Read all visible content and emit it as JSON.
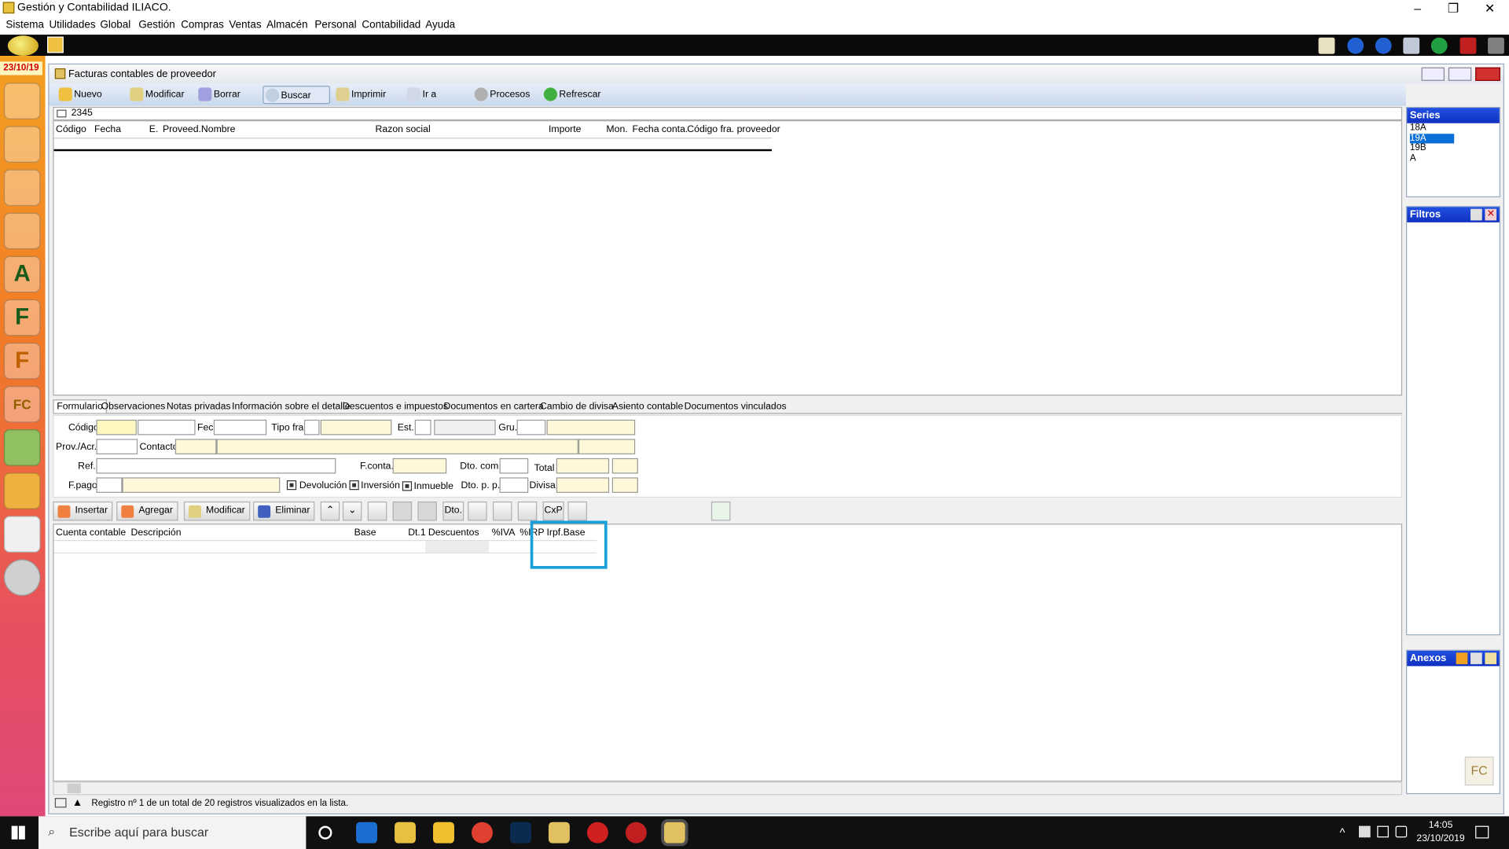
{
  "window": {
    "title": "Gestión y Contabilidad ILIACO.",
    "minimize": "–",
    "restore": "❐",
    "close": "✕"
  },
  "menu": [
    "Sistema",
    "Utilidades",
    "Global",
    "Gestión",
    "Compras",
    "Ventas",
    "Almacén",
    "Personal",
    "Contabilidad",
    "Ayuda"
  ],
  "rail": {
    "date": "23/10/19",
    "icons": [
      "users-icon",
      "user-icon",
      "user-p-icon",
      "user-a-icon",
      "letter-a-icon",
      "letter-f-icon",
      "letter-f-orange-icon",
      "fc-icon",
      "bag-green-icon",
      "bag-orange-icon",
      "ledger-icon",
      "disk-icon"
    ],
    "letters": [
      "",
      "",
      "",
      "",
      "A",
      "F",
      "F",
      "FC",
      "",
      "",
      "",
      ""
    ]
  },
  "subwindow": {
    "title": "Facturas contables de proveedor"
  },
  "toolbar": {
    "nuevo": "Nuevo",
    "modificar": "Modificar",
    "borrar": "Borrar",
    "buscar": "Buscar",
    "imprimir": "Imprimir",
    "ir_a": "Ir a",
    "procesos": "Procesos",
    "refrescar": "Refrescar"
  },
  "search": {
    "value": "2345"
  },
  "list_columns": [
    "Código",
    "Fecha",
    "E.",
    "Proveed.",
    "Nombre",
    "Razon social",
    "Importe",
    "Mon.",
    "Fecha conta.",
    "Código fra. proveedor"
  ],
  "series": {
    "title": "Series",
    "items": [
      "18A",
      "19A",
      "19B",
      "A"
    ],
    "selected": "19A"
  },
  "filtros": {
    "title": "Filtros"
  },
  "anexos": {
    "title": "Anexos"
  },
  "tabs": [
    "Formulario",
    "Observaciones",
    "Notas privadas",
    "Información sobre el detalle",
    "Descuentos e impuestos",
    "Documentos en cartera",
    "Cambio de divisa",
    "Asiento contable",
    "Documentos vinculados"
  ],
  "form": {
    "codigo": "Código",
    "fec": "Fec.",
    "tipo_fra": "Tipo fra.",
    "est": "Est.",
    "gru": "Gru.",
    "prov": "Prov./Acr.",
    "contacto": "Contacto",
    "ref": "Ref.",
    "fconta": "F.conta.",
    "dto_com": "Dto. com.",
    "total": "Total",
    "fpago": "F.pago",
    "devolucion": "Devolución",
    "inversion": "Inversión",
    "inmueble": "Inmueble",
    "dto_pp": "Dto. p. p.",
    "divisa": "Divisa"
  },
  "detail_toolbar": {
    "insertar": "Insertar",
    "agregar": "Agregar",
    "modificar": "Modificar",
    "eliminar": "Eliminar",
    "up": "⌃",
    "down": "⌄",
    "dto": "Dto.",
    "cxp": "CxP"
  },
  "detail_columns": [
    "Cuenta contable",
    "Descripción",
    "Base",
    "Dt.1",
    "Descuentos",
    "%IVA",
    "%IRPF",
    "Irpf.Base"
  ],
  "status": {
    "text": "Registro nº 1 de un total de 20 registros visualizados en la lista."
  },
  "taskbar": {
    "search_placeholder": "Escribe aquí para buscar",
    "time": "14:05",
    "date": "23/10/2019"
  },
  "colors": {
    "accent": "#1030c0",
    "highlight": "#1aa0d8",
    "yellow_field": "#fff8c0"
  }
}
